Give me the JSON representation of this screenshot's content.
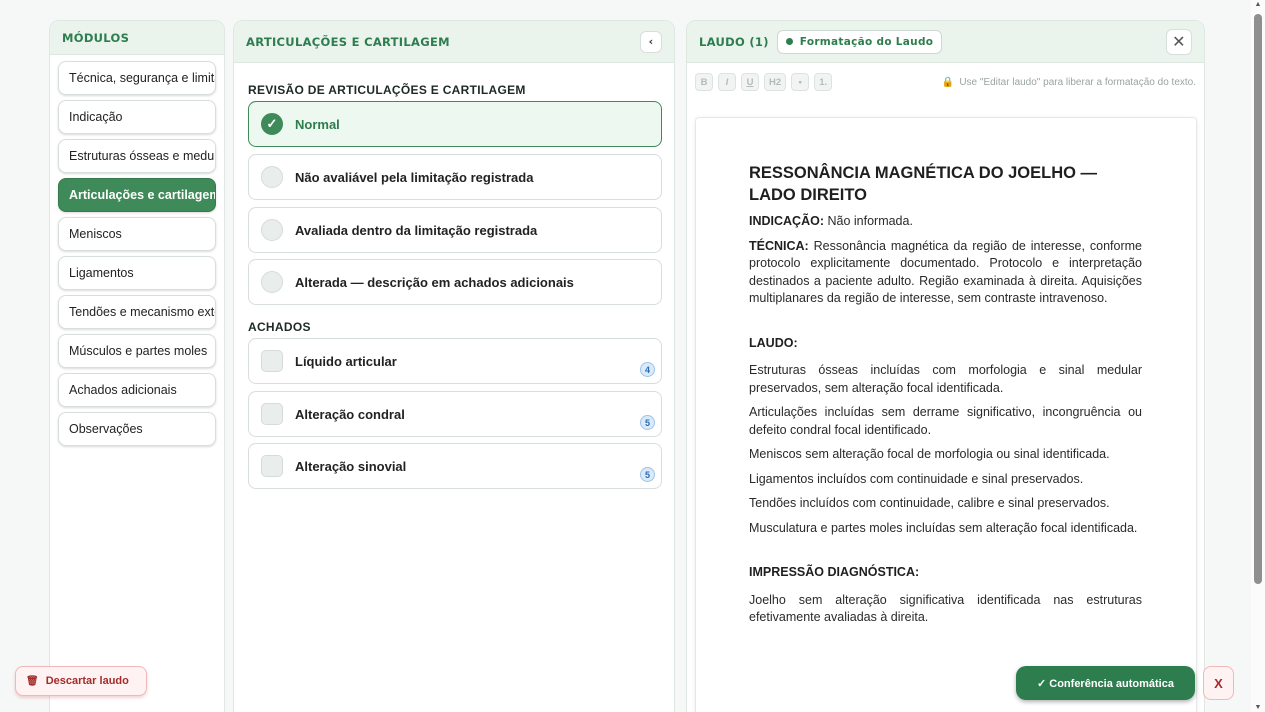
{
  "modules": {
    "title": "MÓDULOS",
    "items": [
      "Técnica, segurança e limitações",
      "Indicação",
      "Estruturas ósseas e medulares",
      "Articulações e cartilagem",
      "Meniscos",
      "Ligamentos",
      "Tendões e mecanismo extensor",
      "Músculos e partes moles",
      "Achados adicionais",
      "Observações"
    ],
    "active_index": 3
  },
  "middle": {
    "title": "ARTICULAÇÕES E CARTILAGEM",
    "collapse_icon": "‹",
    "review_label": "REVISÃO DE ARTICULAÇÕES E CARTILAGEM",
    "options": [
      {
        "label": "Normal",
        "selected": true
      },
      {
        "label": "Não avaliável pela limitação registrada",
        "selected": false
      },
      {
        "label": "Avaliada dentro da limitação registrada",
        "selected": false
      },
      {
        "label": "Alterada — descrição em achados adicionais",
        "selected": false
      }
    ],
    "findings_label": "ACHADOS",
    "findings": [
      {
        "label": "Líquido articular",
        "count": "4"
      },
      {
        "label": "Alteração condral",
        "count": "5"
      },
      {
        "label": "Alteração sinovial",
        "count": "5"
      }
    ]
  },
  "laudo": {
    "title": "LAUDO (1)",
    "format_chip": "Formatação do Laudo",
    "close_icon": "✕",
    "toolbar": {
      "bold": "B",
      "italic": "I",
      "underline": "U",
      "h2": "H2",
      "bullet": "•",
      "numbered": "1.",
      "hint": "Use \"Editar laudo\" para liberar a formatação do texto."
    },
    "doc": {
      "heading": "RESSONÂNCIA MAGNÉTICA DO JOELHO — LADO DIREITO",
      "indicacao_key": "INDICAÇÃO:",
      "indicacao_val": " Não informada.",
      "tecnica_key": "TÉCNICA:",
      "tecnica_val": " Ressonância magnética da região de interesse, conforme protocolo explicitamente documentado. Protocolo e interpretação destinados a paciente adulto. Região examinada à direita. Aquisições multiplanares da região de interesse, sem contraste intravenoso.",
      "laudo_heading": "LAUDO:",
      "laudo_lines": [
        "Estruturas ósseas incluídas com morfologia e sinal medular preservados, sem alteração focal identificada.",
        "Articulações incluídas sem derrame significativo, incongruência ou defeito condral focal identificado.",
        "Meniscos sem alteração focal de morfologia ou sinal identificada.",
        "Ligamentos incluídos com continuidade e sinal preservados.",
        "Tendões incluídos com continuidade, calibre e sinal preservados.",
        "Musculatura e partes moles incluídas sem alteração focal identificada."
      ],
      "impressao_heading": "IMPRESSÃO DIAGNÓSTICA:",
      "impressao_text": "Joelho sem alteração significativa identificada nas estruturas efetivamente avaliadas à direita."
    }
  },
  "actions": {
    "discard": "Descartar laudo",
    "auto_check": "✓ Conferência automática",
    "close_x": "X"
  },
  "colors": {
    "accent_green": "#2e7d4f",
    "active_module": "#3e8a58",
    "danger": "#a52b2b"
  }
}
